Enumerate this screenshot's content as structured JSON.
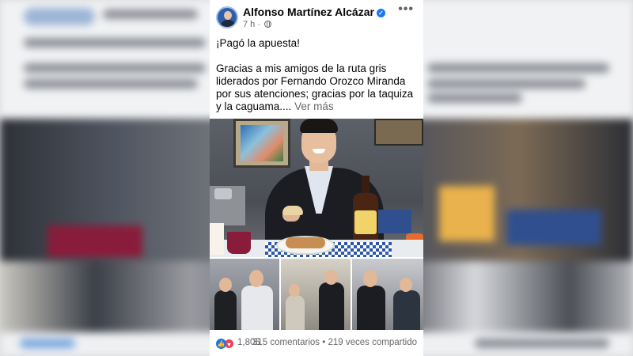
{
  "post": {
    "author": "Alfonso Martínez Alcázar",
    "time": "7 h",
    "text_first": "¡Pagó la apuesta!",
    "text_body": "Gracias a mis amigos de la ruta gris liderados por Fernando Orozco Miranda por sus atenciones; gracias por la taquiza y la caguama....",
    "see_more": "Ver más"
  },
  "reactions": {
    "count": "1,805",
    "comments": "315 comentarios",
    "separator": "•",
    "shares": "219 veces compartido"
  },
  "icons": {
    "verified": "verified-badge-icon",
    "privacy": "globe-icon",
    "more": "more-options-icon",
    "like": "like-icon",
    "love": "love-icon"
  },
  "colors": {
    "accent": "#1877f2",
    "love": "#f33e58",
    "secondary_text": "#65676b"
  }
}
